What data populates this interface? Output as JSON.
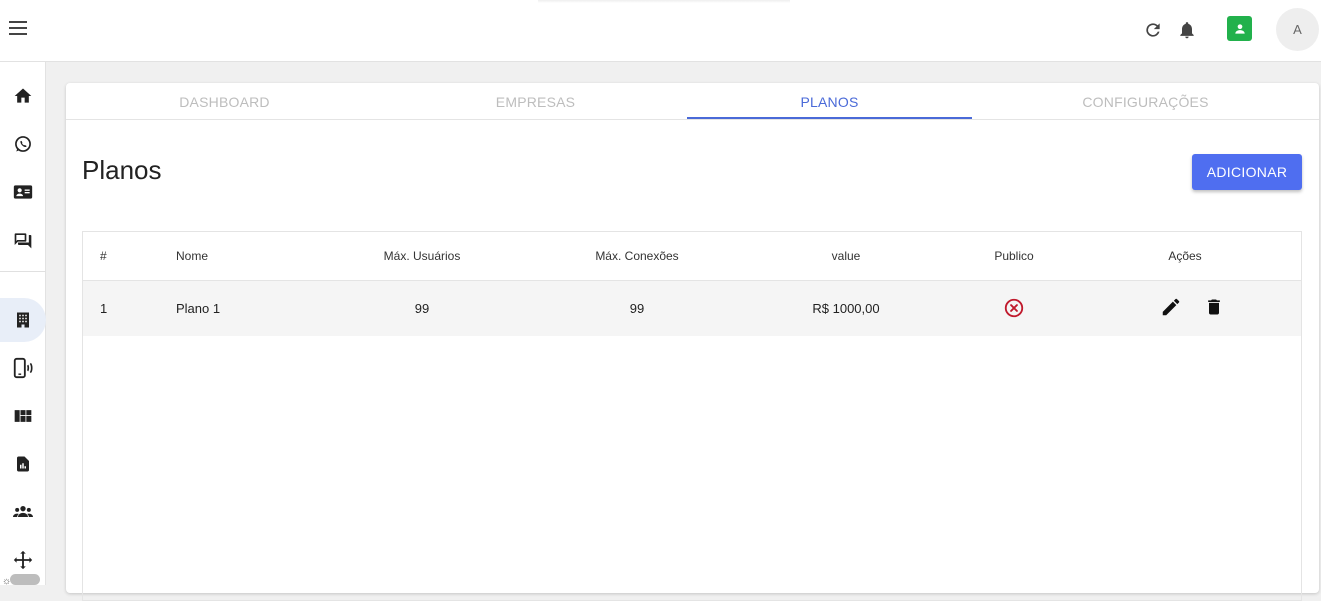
{
  "header": {
    "avatar_initial": "A",
    "icons": [
      "menu-icon",
      "refresh-icon",
      "bell-icon",
      "whatsapp-icon",
      "avatar"
    ]
  },
  "sidebar": {
    "items": [
      "home-icon",
      "whatsapp-icon",
      "contacts-icon",
      "chat-icon",
      "building-icon",
      "phone-icon",
      "dashboard-icon",
      "report-icon",
      "users-icon",
      "move-icon"
    ],
    "active": "building-icon"
  },
  "tabs": [
    {
      "label": "DASHBOARD"
    },
    {
      "label": "EMPRESAS"
    },
    {
      "label": "PLANOS"
    },
    {
      "label": "CONFIGURAÇÕES"
    }
  ],
  "active_tab": "PLANOS",
  "page": {
    "title": "Planos",
    "add_button": "ADICIONAR"
  },
  "table": {
    "headers": {
      "num": "#",
      "name": "Nome",
      "users": "Máx. Usuários",
      "connections": "Máx. Conexões",
      "value": "value",
      "public": "Publico",
      "actions": "Ações"
    },
    "rows": [
      {
        "num": "1",
        "name": "Plano 1",
        "users": "99",
        "connections": "99",
        "value": "R$ 1000,00",
        "public": false
      }
    ]
  },
  "colors": {
    "accent": "#4a6ad8",
    "button": "#4f6ef0",
    "whatsapp": "#22b14c",
    "error": "#c0192c"
  }
}
